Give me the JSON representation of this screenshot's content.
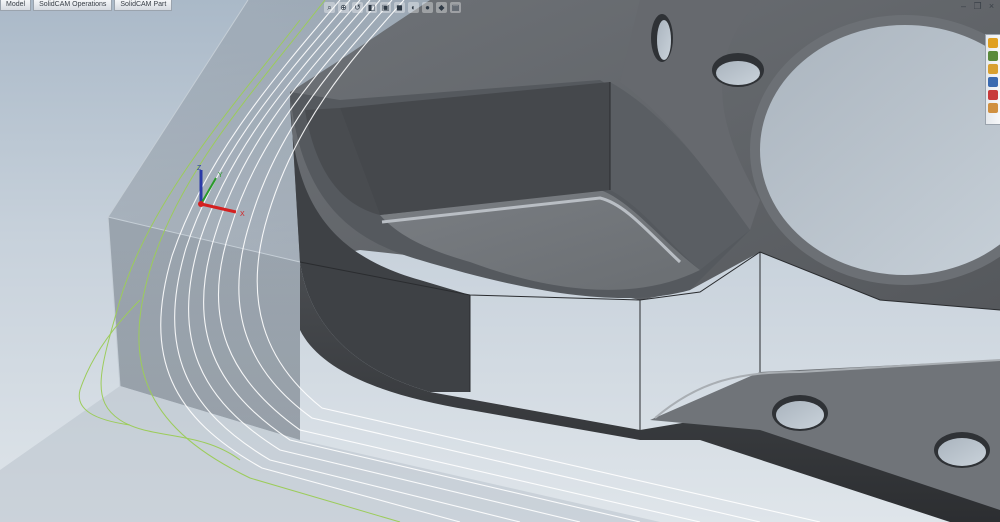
{
  "tabs": [
    {
      "label": "Model"
    },
    {
      "label": "SolidCAM Operations"
    },
    {
      "label": "SolidCAM Part"
    }
  ],
  "view_toolbar": [
    {
      "icon": "zoom-fit-icon",
      "glyph": "⌕"
    },
    {
      "icon": "zoom-area-icon",
      "glyph": "⊕"
    },
    {
      "icon": "previous-view-icon",
      "glyph": "↺"
    },
    {
      "icon": "section-view-icon",
      "glyph": "◧"
    },
    {
      "icon": "view-orientation-icon",
      "glyph": "▣"
    },
    {
      "icon": "display-style-icon",
      "glyph": "◼"
    },
    {
      "icon": "hide-show-icon",
      "glyph": "◐"
    },
    {
      "icon": "edit-appearance-icon",
      "glyph": "●"
    },
    {
      "icon": "apply-scene-icon",
      "glyph": "◆"
    },
    {
      "icon": "view-settings-icon",
      "glyph": "▤"
    }
  ],
  "window_controls": [
    {
      "icon": "minimize-icon",
      "glyph": "–"
    },
    {
      "icon": "restore-icon",
      "glyph": "❐"
    },
    {
      "icon": "close-icon",
      "glyph": "×"
    }
  ],
  "task_pane": [
    {
      "icon": "solidworks-resources-icon",
      "color": "#e0a020"
    },
    {
      "icon": "design-library-icon",
      "color": "#5a8a3a"
    },
    {
      "icon": "file-explorer-icon",
      "color": "#d8a030"
    },
    {
      "icon": "view-palette-icon",
      "color": "#3a6ab0"
    },
    {
      "icon": "appearances-icon",
      "color": "#c83a3a"
    },
    {
      "icon": "custom-properties-icon",
      "color": "#d09040"
    }
  ],
  "triad": {
    "x_label": "X",
    "y_label": "Y",
    "z_label": "Z"
  },
  "colors": {
    "part": "#5c5f63",
    "stock": "#8e99a4",
    "toolpath_white": "#ffffff",
    "toolpath_green": "#9ccc5a"
  }
}
